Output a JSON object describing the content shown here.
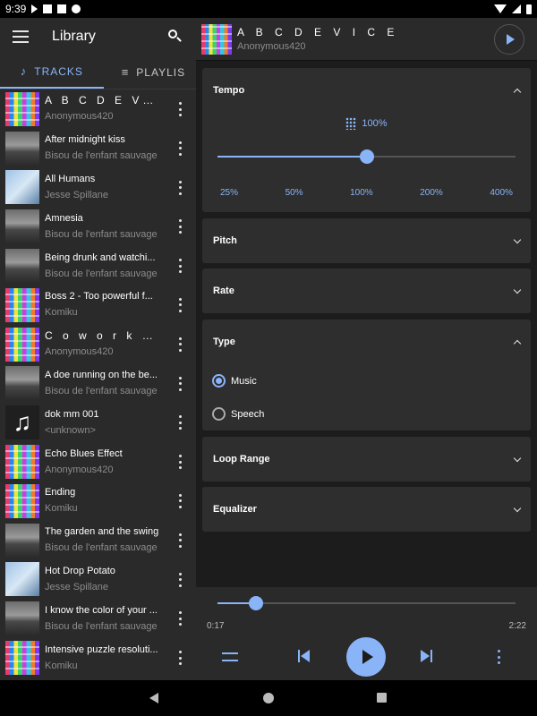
{
  "status_bar": {
    "time": "9:39"
  },
  "library": {
    "title": "Library",
    "tabs": [
      {
        "label": "TRACKS",
        "icon": "music-note-icon"
      },
      {
        "label": "PLAYLIS",
        "icon": "playlist-icon"
      }
    ],
    "tracks": [
      {
        "title": "A B C D E V I C E",
        "artist": "Anonymous420",
        "art": "colorful"
      },
      {
        "title": "After midnight kiss",
        "artist": "Bisou de l'enfant sauvage",
        "art": "gray"
      },
      {
        "title": "All Humans",
        "artist": "Jesse Spillane",
        "art": "blue"
      },
      {
        "title": "Amnesia",
        "artist": "Bisou de l'enfant sauvage",
        "art": "gray"
      },
      {
        "title": "Being drunk and watchi...",
        "artist": "Bisou de l'enfant sauvage",
        "art": "gray"
      },
      {
        "title": "Boss 2 - Too powerful f...",
        "artist": "Komiku",
        "art": "colorful"
      },
      {
        "title": "C o w o r k P a r t...",
        "artist": "Anonymous420",
        "art": "colorful"
      },
      {
        "title": "A doe running on the be...",
        "artist": "Bisou de l'enfant sauvage",
        "art": "gray"
      },
      {
        "title": "dok mm 001",
        "artist": "<unknown>",
        "art": "note"
      },
      {
        "title": "Echo Blues Effect",
        "artist": "Anonymous420",
        "art": "colorful"
      },
      {
        "title": "Ending",
        "artist": "Komiku",
        "art": "colorful"
      },
      {
        "title": "The garden and the swing",
        "artist": "Bisou de l'enfant sauvage",
        "art": "gray"
      },
      {
        "title": "Hot Drop Potato",
        "artist": "Jesse Spillane",
        "art": "blue"
      },
      {
        "title": "I know the color of your ...",
        "artist": "Bisou de l'enfant sauvage",
        "art": "gray"
      },
      {
        "title": "Intensive puzzle resoluti...",
        "artist": "Komiku",
        "art": "colorful"
      }
    ]
  },
  "now_playing": {
    "title": "A B C D E V I C E",
    "artist": "Anonymous420"
  },
  "sections": {
    "tempo": "Tempo",
    "pitch": "Pitch",
    "rate": "Rate",
    "type": "Type",
    "loop_range": "Loop Range",
    "equalizer": "Equalizer"
  },
  "tempo": {
    "value_label": "100%",
    "level": 0.5,
    "ticks": [
      "25%",
      "50%",
      "100%",
      "200%",
      "400%"
    ]
  },
  "type_options": [
    {
      "label": "Music",
      "selected": true
    },
    {
      "label": "Speech",
      "selected": false
    }
  ],
  "player": {
    "elapsed": "0:17",
    "duration": "2:22",
    "progress": 0.128
  },
  "colors": {
    "accent": "#8ab4f8",
    "panel": "#2a2a2a",
    "card": "#2e2e2e"
  }
}
